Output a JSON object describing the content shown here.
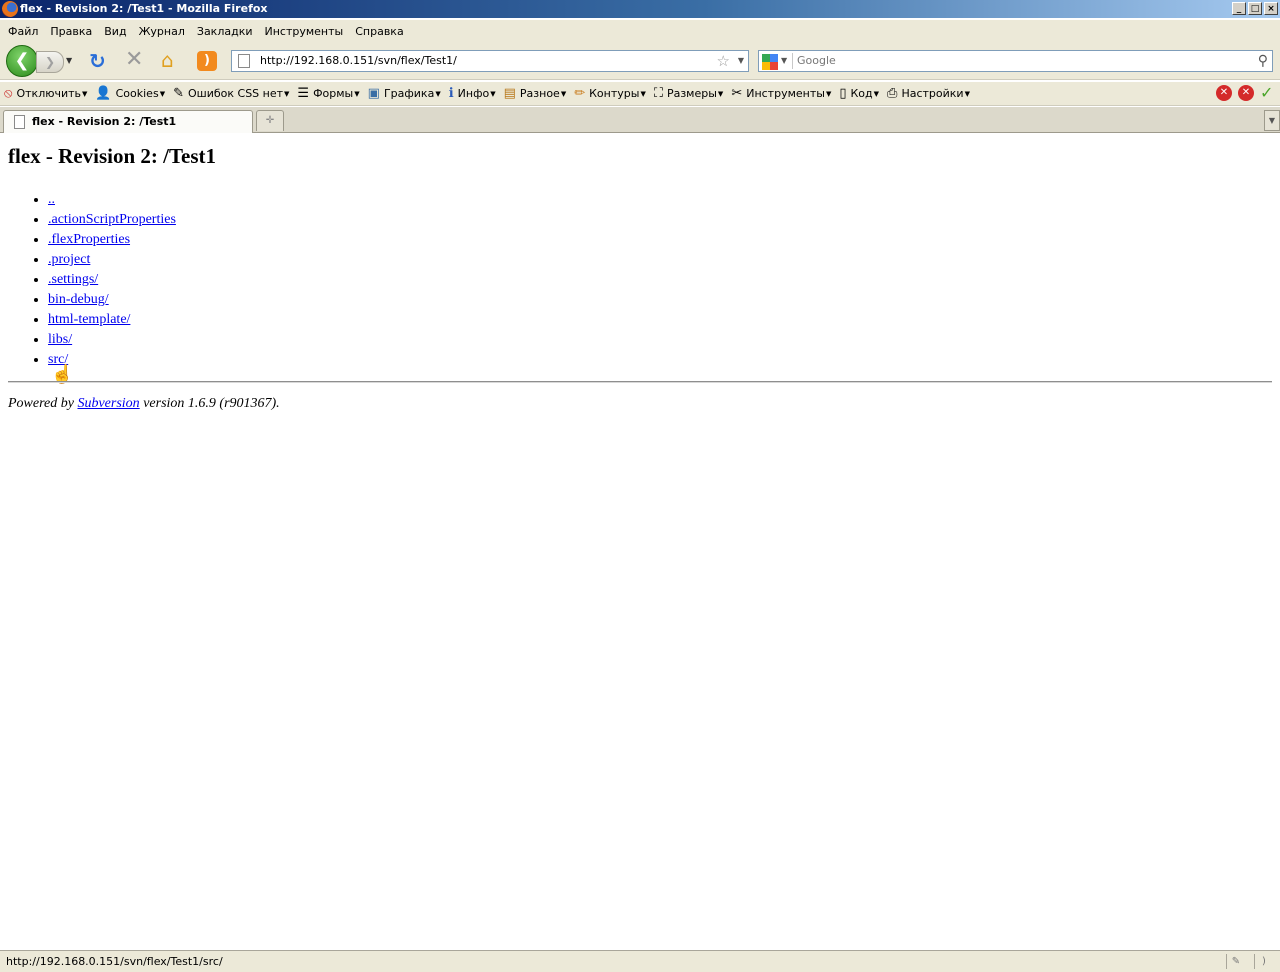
{
  "window": {
    "title": "flex - Revision 2: /Test1 - Mozilla Firefox",
    "controls": [
      "_",
      "□",
      "×"
    ]
  },
  "menu": [
    "Файл",
    "Правка",
    "Вид",
    "Журнал",
    "Закладки",
    "Инструменты",
    "Справка"
  ],
  "nav": {
    "url": "http://192.168.0.151/svn/flex/Test1/",
    "search_placeholder": "Google"
  },
  "devtoolbar": [
    {
      "label": "Отключить",
      "icon": "disable-icon",
      "glyph": "⦸"
    },
    {
      "label": "Cookies",
      "icon": "cookies-icon",
      "glyph": "👤"
    },
    {
      "label": "Ошибок CSS нет",
      "icon": "css-icon",
      "glyph": "✎"
    },
    {
      "label": "Формы",
      "icon": "forms-icon",
      "glyph": "☰"
    },
    {
      "label": "Графика",
      "icon": "images-icon",
      "glyph": "▣"
    },
    {
      "label": "Инфо",
      "icon": "info-icon",
      "glyph": "ℹ"
    },
    {
      "label": "Разное",
      "icon": "misc-icon",
      "glyph": "▤"
    },
    {
      "label": "Контуры",
      "icon": "outline-icon",
      "glyph": "✏"
    },
    {
      "label": "Размеры",
      "icon": "resize-icon",
      "glyph": "⛶"
    },
    {
      "label": "Инструменты",
      "icon": "tools-icon",
      "glyph": "✂"
    },
    {
      "label": "Код",
      "icon": "source-icon",
      "glyph": "▯"
    },
    {
      "label": "Настройки",
      "icon": "options-icon",
      "glyph": "⎙"
    }
  ],
  "tabs": [
    {
      "label": "flex - Revision 2: /Test1"
    }
  ],
  "page": {
    "heading": "flex - Revision 2: /Test1",
    "items": [
      "..",
      ".actionScriptProperties",
      ".flexProperties",
      ".project",
      ".settings/",
      "bin-debug/",
      "html-template/",
      "libs/",
      "src/"
    ],
    "footer_prefix": "Powered by",
    "footer_link": "Subversion",
    "footer_suffix": "version 1.6.9 (r901367)."
  },
  "status": {
    "text": "http://192.168.0.151/svn/flex/Test1/src/"
  }
}
